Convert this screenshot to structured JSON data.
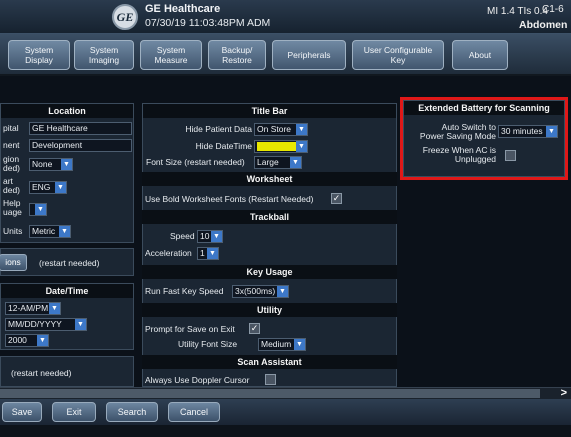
{
  "header": {
    "logo": "GE",
    "brand": "GE Healthcare",
    "datetime": "07/30/19 11:03:48PM  ADM",
    "mi_tis": "MI 1.4  TIs 0.4",
    "probe": "C1-6",
    "preset": "Abdomen"
  },
  "tabs": [
    {
      "label": "System Display"
    },
    {
      "label": "System Imaging"
    },
    {
      "label": "System Measure"
    },
    {
      "label": "Backup/ Restore"
    },
    {
      "label": "Peripherals"
    },
    {
      "label": "User Configurable Key"
    },
    {
      "label": "About"
    }
  ],
  "location": {
    "title": "Location",
    "hospital_label": "pital",
    "hospital_value": "GE Healthcare",
    "department_label": "nent",
    "department_value": "Development",
    "region_label": "gion\nded)",
    "region_value": "None",
    "start_label": "art\nded)",
    "start_value": "ENG",
    "help_label": "Help\nuage",
    "units_label": "Units",
    "units_value": "Metric"
  },
  "options": {
    "button_label": "ions",
    "note": "(restart needed)"
  },
  "date_time": {
    "title": "Date/Time",
    "time_format": "12-AM/PM",
    "date_format": "MM/DD/YYYY",
    "year": "2000",
    "note": "(restart needed)"
  },
  "title_bar": {
    "title": "Title Bar",
    "hide_patient_label": "Hide Patient Data",
    "hide_patient_value": "On Store",
    "hide_datetime_label": "Hide DateTime",
    "font_size_label": "Font Size (restart needed)",
    "font_size_value": "Large"
  },
  "worksheet": {
    "title": "Worksheet",
    "bold_fonts_label": "Use Bold Worksheet Fonts (Restart Needed)",
    "bold_fonts_checked": "✓"
  },
  "trackball": {
    "title": "Trackball",
    "speed_label": "Speed",
    "speed_value": "10",
    "accel_label": "Acceleration",
    "accel_value": "1"
  },
  "key_usage": {
    "title": "Key Usage",
    "fast_key_label": "Run Fast Key Speed",
    "fast_key_value": "3x(500ms)"
  },
  "utility": {
    "title": "Utility",
    "prompt_save_label": "Prompt for Save on Exit",
    "prompt_save_checked": "✓",
    "font_size_label": "Utility Font Size",
    "font_size_value": "Medium"
  },
  "scan_assistant": {
    "title": "Scan Assistant",
    "doppler_label": "Always Use Doppler Cursor"
  },
  "battery": {
    "title": "Extended Battery for Scanning",
    "auto_switch_label": "Auto Switch to\nPower Saving Mode",
    "auto_switch_value": "30 minutes",
    "freeze_label": "Freeze When AC is\nUnplugged"
  },
  "bottom": {
    "save": "Save",
    "exit": "Exit",
    "search": "Search",
    "cancel": "Cancel",
    "scroll_arrow": ">"
  },
  "colors": {
    "highlight_box": "#e01818",
    "hide_datetime_field": "#e8e800",
    "dropdown_arrow": "#3d78c8"
  }
}
